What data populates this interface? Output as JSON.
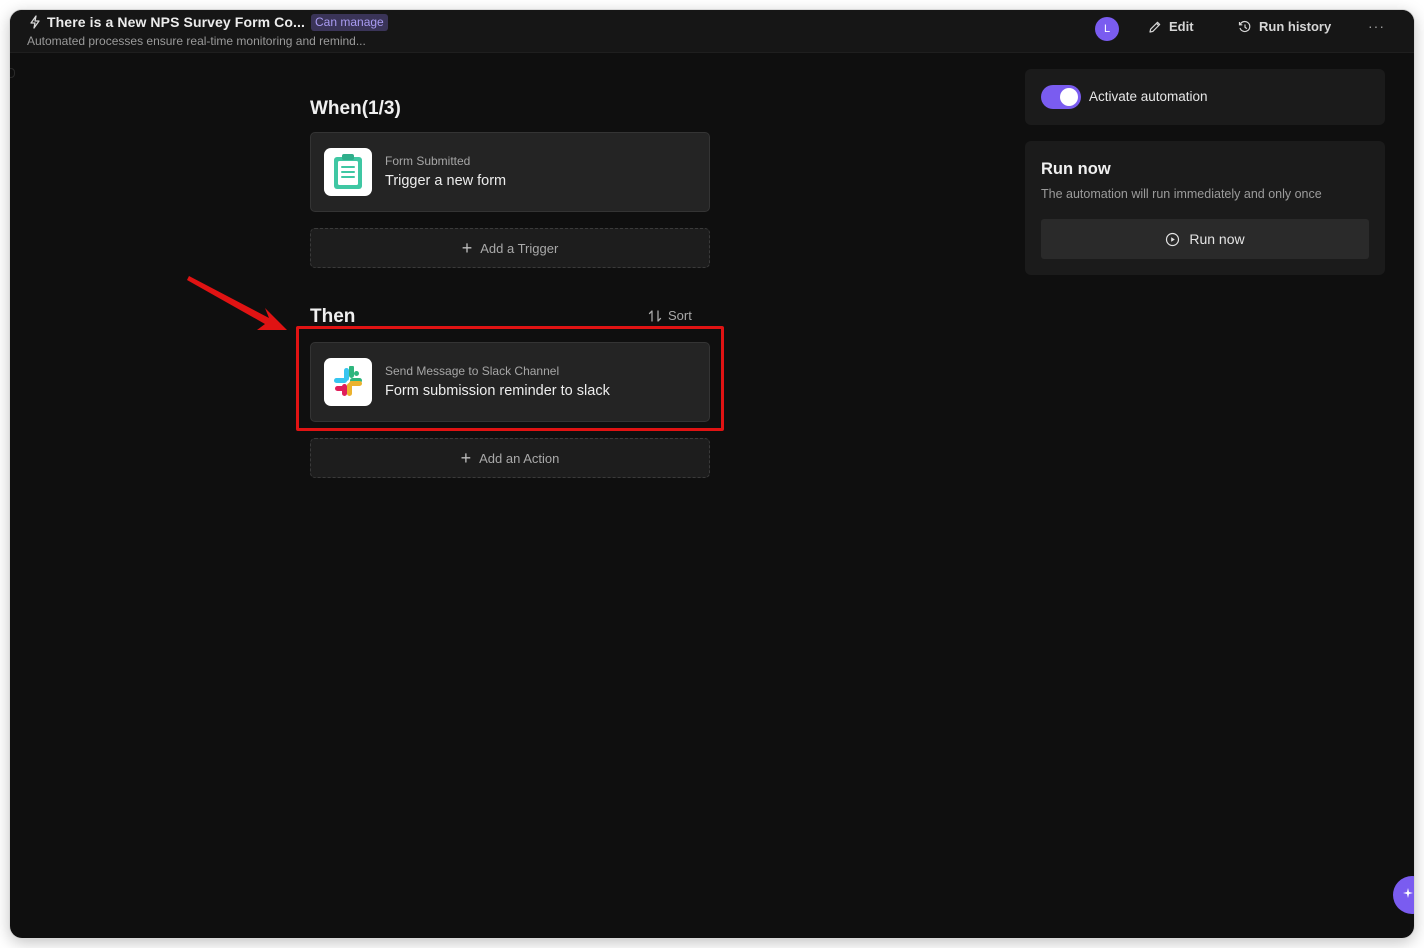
{
  "header": {
    "title": "There is a New NPS Survey Form Co...",
    "badge": "Can manage",
    "subtitle": "Automated processes ensure real-time monitoring and remind...",
    "avatar_letter": "L",
    "edit_label": "Edit",
    "run_history_label": "Run history",
    "more_label": "···"
  },
  "when": {
    "title": "When(1/3)",
    "trigger": {
      "type": "Form Submitted",
      "name": "Trigger a new form",
      "icon": "clipboard-icon"
    },
    "add_trigger_label": "Add a Trigger"
  },
  "then": {
    "title": "Then",
    "sort_label": "Sort",
    "action": {
      "type": "Send Message to Slack Channel",
      "name": "Form submission reminder to slack",
      "icon": "slack-icon"
    },
    "add_action_label": "Add an Action"
  },
  "sidebar": {
    "activate_label": "Activate automation",
    "activate_on": true,
    "run_now_title": "Run now",
    "run_now_desc": "The automation will run immediately and only once",
    "run_now_button": "Run now"
  },
  "colors": {
    "accent": "#7a5cf0",
    "highlight": "#e01313",
    "background": "#0f0f0f"
  }
}
